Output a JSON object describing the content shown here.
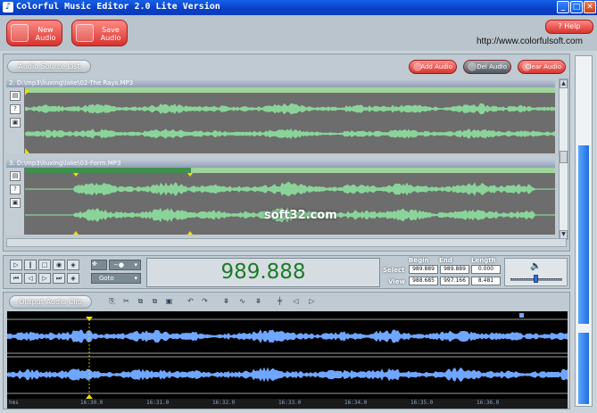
{
  "window": {
    "title": "Colorful Music Editor 2.0 Lite Version",
    "min": "_",
    "max": "□",
    "close": "✕"
  },
  "toolbar": {
    "new_audio": "New\nAudio",
    "save_audio": "Save\nAudio",
    "help": "? Help",
    "url": "http://www.colorfulsoft.com"
  },
  "source": {
    "list_label": "Audio Source List",
    "add": "Add Audio",
    "del": "Del Audio",
    "clear": "Clear Audio",
    "tracks": [
      {
        "label": "2. D:\\mp3\\liuxing\\lake\\02-The Rays.MP3"
      },
      {
        "label": "3. D:\\mp3\\liuxing\\lake\\03-Form.MP3"
      }
    ]
  },
  "transport": {
    "time": "989.888",
    "goto": "Goto",
    "select_label": "Select",
    "view_label": "View",
    "begin_head": "Begin",
    "end_head": "End",
    "length_head": "Length",
    "select": {
      "begin": "989.889",
      "end": "989.889",
      "length": "0.000"
    },
    "view": {
      "begin": "988.685",
      "end": "997.166",
      "length": "8.481"
    }
  },
  "output": {
    "clip_label": "Output Audio Clip",
    "ruler": [
      "hms",
      "16:30.0",
      "16:31.0",
      "16:32.0",
      "16:33.0",
      "16:34.0",
      "16:35.0",
      "16:36.0"
    ]
  },
  "watermark": "soft32.com",
  "colors": {
    "wave_green": "#8ad49a",
    "wave_blue": "#6fa6ff",
    "accent_red": "#d8322d"
  }
}
